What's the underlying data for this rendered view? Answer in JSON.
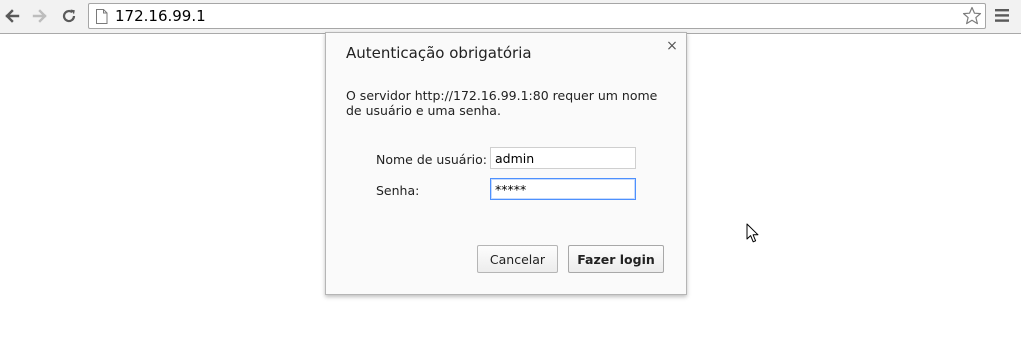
{
  "browser": {
    "url": "172.16.99.1",
    "icons": {
      "back": "arrow-left-icon",
      "forward": "arrow-right-icon",
      "reload": "reload-icon",
      "page": "page-icon",
      "bookmark": "star-icon",
      "menu": "hamburger-menu-icon"
    }
  },
  "dialog": {
    "title": "Autenticação obrigatória",
    "close_glyph": "×",
    "message": "O servidor http://172.16.99.1:80 requer um nome de usuário e uma senha.",
    "username": {
      "label": "Nome de usuário:",
      "value": "admin"
    },
    "password": {
      "label": "Senha:",
      "value": "*****"
    },
    "cancel_label": "Cancelar",
    "login_label": "Fazer login"
  },
  "colors": {
    "toolbar_bg": "#f2f2f2",
    "focus_border": "#4d90fe"
  }
}
